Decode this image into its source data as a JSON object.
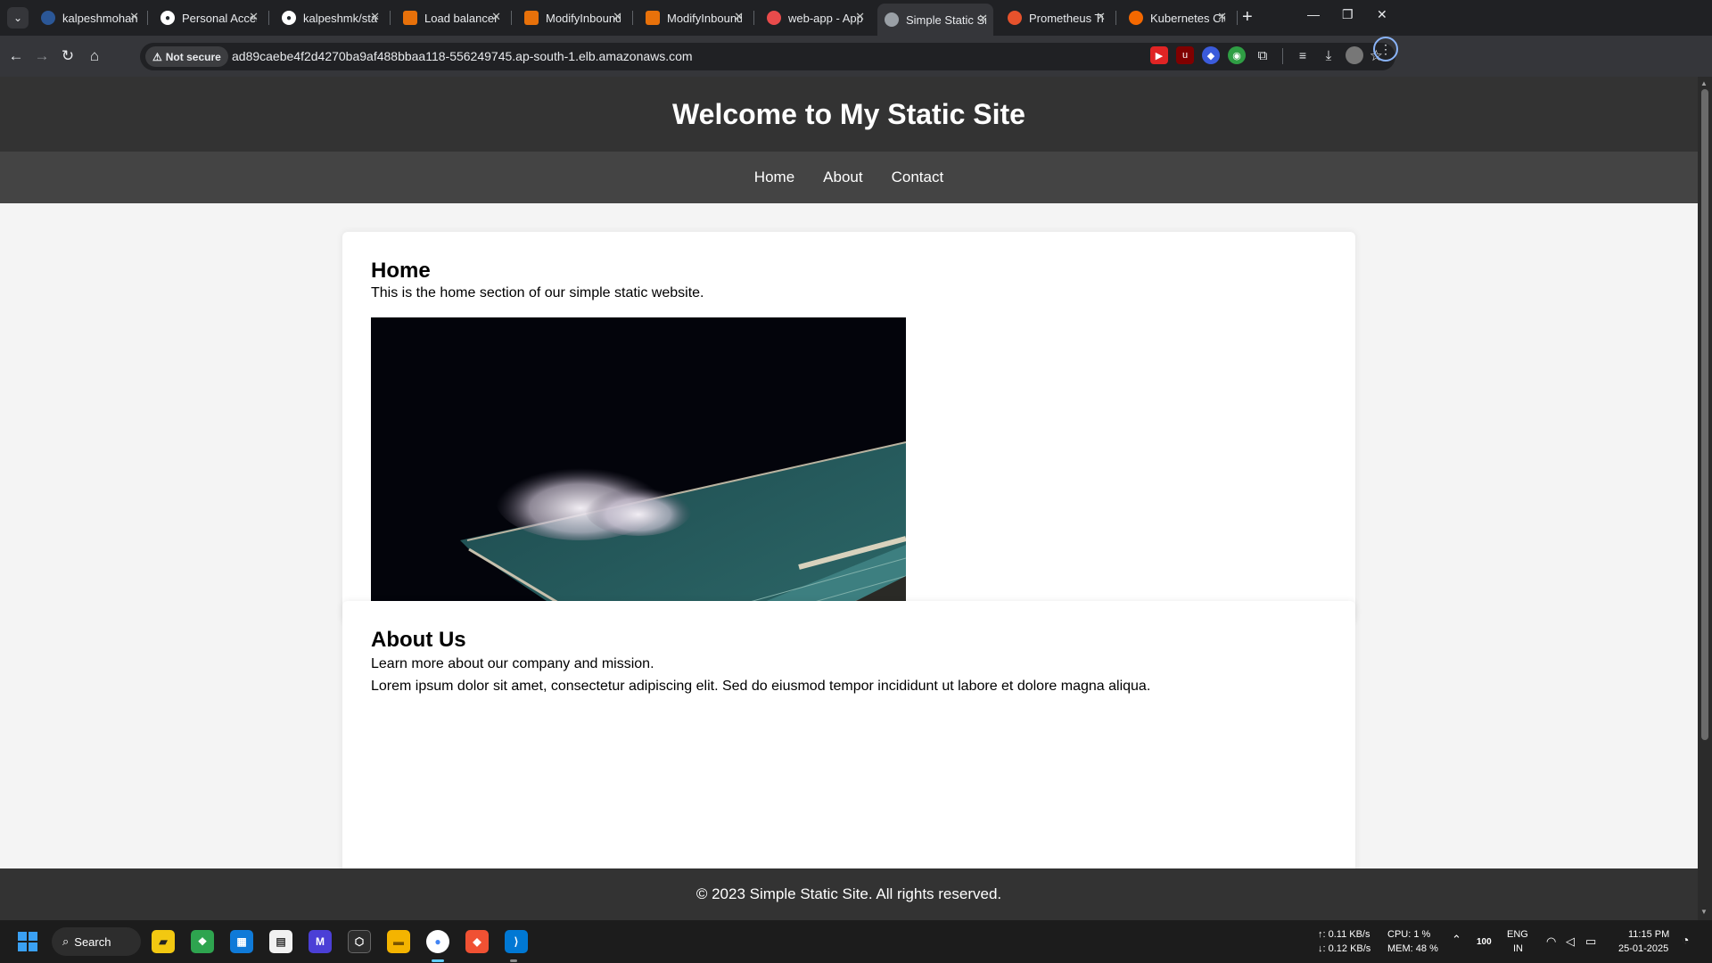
{
  "browser": {
    "tabs": [
      {
        "title": "kalpeshmohanta/",
        "icon_color": "#2b5797",
        "active": false
      },
      {
        "title": "Personal Access T",
        "icon_color": "#24292e",
        "active": false
      },
      {
        "title": "kalpeshmk/static",
        "icon_color": "#24292e",
        "active": false
      },
      {
        "title": "Load balancer det",
        "icon_color": "#e8710a",
        "active": false
      },
      {
        "title": "ModifyInboundSe",
        "icon_color": "#e8710a",
        "active": false
      },
      {
        "title": "ModifyInboundSe",
        "icon_color": "#e8710a",
        "active": false
      },
      {
        "title": "web-app - Applic",
        "icon_color": "#e94b4b",
        "active": false
      },
      {
        "title": "Simple Static Site",
        "icon_color": "#9aa0a6",
        "active": true
      },
      {
        "title": "Prometheus Time",
        "icon_color": "#e6522c",
        "active": false
      },
      {
        "title": "Kubernetes Cluste",
        "icon_color": "#f46800",
        "active": false
      }
    ],
    "security_label": "Not secure",
    "url": "ad89caebe4f2d4270ba9af488bbaa118-556249745.ap-south-1.elb.amazonaws.com"
  },
  "site": {
    "header_title": "Welcome to My Static Site",
    "nav": [
      "Home",
      "About",
      "Contact"
    ],
    "home": {
      "heading": "Home",
      "text": "This is the home section of our simple static website."
    },
    "about": {
      "heading": "About Us",
      "text1": "Learn more about our company and mission.",
      "text2": "Lorem ipsum dolor sit amet, consectetur adipiscing elit. Sed do eiusmod tempor incididunt ut labore et dolore magna aliqua."
    },
    "footer": "© 2023 Simple Static Site. All rights reserved."
  },
  "taskbar": {
    "search_label": "Search",
    "net_up": "↑: 0.11 KB/s",
    "net_down": "↓: 0.12 KB/s",
    "cpu": "CPU: 1 %",
    "mem": "MEM: 48 %",
    "battery": "100",
    "lang1": "ENG",
    "lang2": "IN",
    "time": "11:15 PM",
    "date": "25-01-2025"
  }
}
